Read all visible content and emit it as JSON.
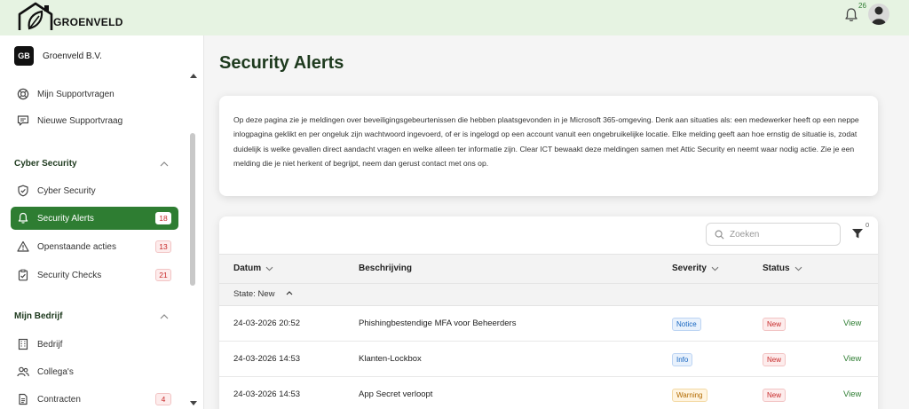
{
  "app": {
    "logo_text": "GROENVELD",
    "notification_count": "26"
  },
  "org": {
    "badge": "GB",
    "name": "Groenveld B.V."
  },
  "sidebar": {
    "top_items": [
      {
        "label": "Mijn Supportvragen",
        "icon": "support-icon"
      },
      {
        "label": "Nieuwe Supportvraag",
        "icon": "chat-icon"
      }
    ],
    "sections": [
      {
        "title": "Cyber Security",
        "items": [
          {
            "label": "Cyber Security",
            "icon": "shield-icon",
            "badge": ""
          },
          {
            "label": "Security Alerts",
            "icon": "bell-icon",
            "badge": "18",
            "active": true
          },
          {
            "label": "Openstaande acties",
            "icon": "warning-icon",
            "badge": "13"
          },
          {
            "label": "Security Checks",
            "icon": "clipboard-icon",
            "badge": "21"
          }
        ]
      },
      {
        "title": "Mijn Bedrijf",
        "items": [
          {
            "label": "Bedrijf",
            "icon": "building-icon",
            "badge": ""
          },
          {
            "label": "Collega's",
            "icon": "users-icon",
            "badge": ""
          },
          {
            "label": "Contracten",
            "icon": "document-icon",
            "badge": "4"
          }
        ]
      }
    ]
  },
  "main": {
    "title": "Security Alerts",
    "intro": "Op deze pagina zie je meldingen over beveiligingsgebeurtenissen die hebben plaatsgevonden in je Microsoft 365-omgeving. Denk aan situaties als: een medewerker heeft op een neppe inlogpagina geklikt en per ongeluk zijn wachtwoord ingevoerd, of er is ingelogd op een account vanuit een ongebruikelijke locatie. Elke melding geeft aan hoe ernstig de situatie is, zodat duidelijk is welke gevallen direct aandacht vragen en welke alleen ter informatie zijn. Clear ICT bewaakt deze meldingen samen met Attic Security en neemt waar nodig actie. Zie je een melding die je niet herkent of begrijpt, neem dan gerust contact met ons op.",
    "search_placeholder": "Zoeken",
    "filter_count": "0",
    "columns": {
      "date": "Datum",
      "description": "Beschrijving",
      "severity": "Severity",
      "status": "Status"
    },
    "group_label": "State: New",
    "rows": [
      {
        "date": "24-03-2026 20:52",
        "description": "Phishingbestendige MFA voor Beheerders",
        "severity": "Notice",
        "status": "New",
        "action": "View"
      },
      {
        "date": "24-03-2026 14:53",
        "description": "Klanten-Lockbox",
        "severity": "Info",
        "status": "New",
        "action": "View"
      },
      {
        "date": "24-03-2026 14:53",
        "description": "App Secret verloopt",
        "severity": "Warning",
        "status": "New",
        "action": "View"
      }
    ]
  },
  "colors": {
    "brand_green": "#2e7d32",
    "header_bg": "#e6f3e2",
    "title_green": "#1e3a1e",
    "badge_red": "#c62828"
  }
}
